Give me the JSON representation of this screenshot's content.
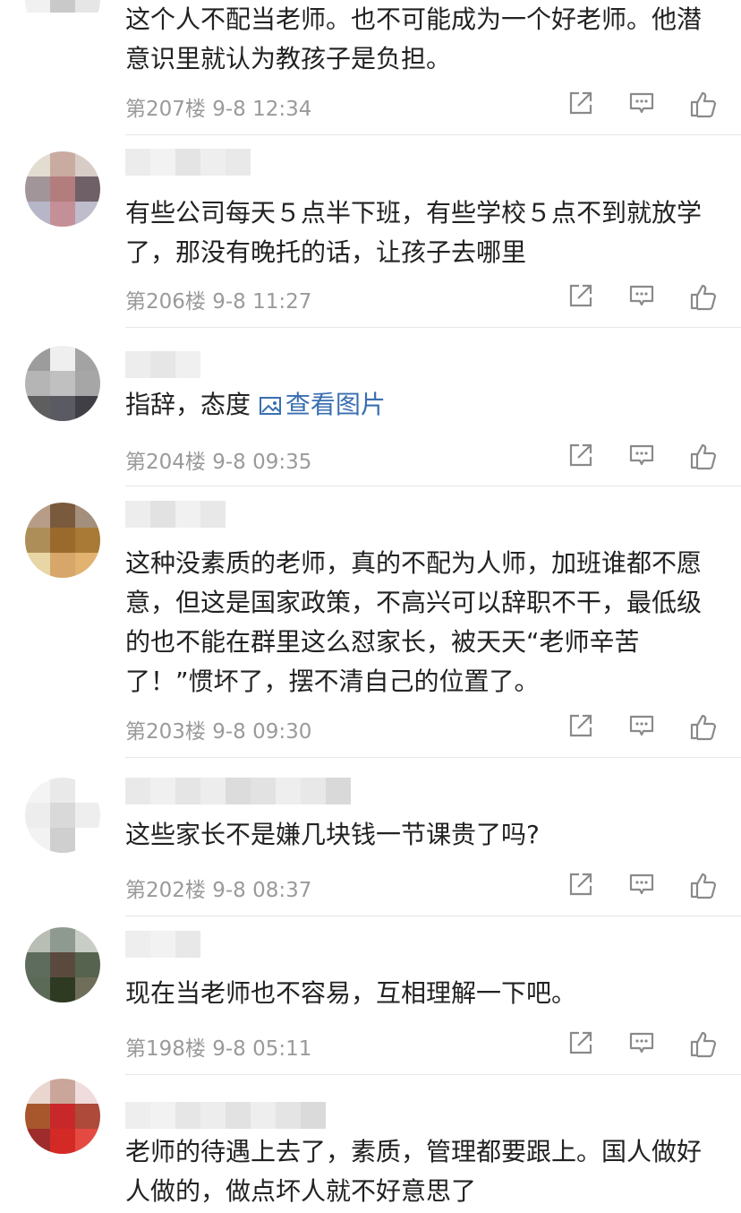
{
  "comments": [
    {
      "text": "这个人不配当老师。也不可能成为一个好老师。他潜意识里就认为教孩子是负担。",
      "floor": "第207楼",
      "time": "9-8 12:34",
      "avatar_colors": [
        "#8a98a8",
        "#d7c07a",
        "#7fb3c6",
        "#f1f1f1",
        "#c9c9c9",
        "#e6e6e6",
        "#ffffff",
        "#ffffff",
        "#ffffff"
      ]
    },
    {
      "text": "有些公司每天５点半下班，有些学校５点不到就放学了，那没有晚托的话，让孩子去哪里",
      "floor": "第206楼",
      "time": "9-8 11:27",
      "avatar_colors": [
        "#e3ddd1",
        "#c9aba1",
        "#d8ccc6",
        "#a29599",
        "#b47d7d",
        "#6f6068",
        "#b6b6c8",
        "#c58f98",
        "#bfbccb"
      ]
    },
    {
      "prefix": "指辞，态度",
      "link": "查看图片",
      "floor": "第204楼",
      "time": "9-8 09:35",
      "avatar_colors": [
        "#9c9c9c",
        "#efefef",
        "#a3a3a3",
        "#b5b5b5",
        "#c0c0c0",
        "#a6a6a6",
        "#5e5e5e",
        "#5a5a62",
        "#3f3f45"
      ]
    },
    {
      "text": "这种没素质的老师，真的不配为人师，加班谁都不愿意，但这是国家政策，不高兴可以辞职不干，最低级的也不能在群里这么怼家长，被天天“老师辛苦了！”惯坏了，摆不清自己的位置了。",
      "floor": "第203楼",
      "time": "9-8 09:30",
      "avatar_colors": [
        "#b79d87",
        "#7a5a3c",
        "#a48e7c",
        "#ae8e58",
        "#9a6a2c",
        "#a87a35",
        "#e8d6a6",
        "#d6a66a",
        "#e2b270"
      ]
    },
    {
      "text": "这些家长不是嫌几块钱一节课贵了吗?",
      "floor": "第202楼",
      "time": "9-8 08:37",
      "avatar_colors": [
        "#f4f4f4",
        "#e9e9e9",
        "#ffffff",
        "#ededed",
        "#d9d9d9",
        "#eeeeee",
        "#f2f2f2",
        "#cfcfcf",
        "#ffffff"
      ]
    },
    {
      "text": "现在当老师也不容易，互相理解一下吧。",
      "floor": "第198楼",
      "time": "9-8 05:11",
      "avatar_colors": [
        "#b9beb4",
        "#8e9a8f",
        "#c8cec6",
        "#5d6c5c",
        "#5a4a3e",
        "#56634f",
        "#5b6a57",
        "#2e3a22",
        "#6f6e5a"
      ]
    },
    {
      "text": "老师的待遇上去了，素质，管理都要跟上。国人做好人做的，做点坏人就不好意思了",
      "floor": "",
      "time": "",
      "avatar_colors": [
        "#e9d7cf",
        "#c9a59a",
        "#f0dcdc",
        "#a8572c",
        "#c8282a",
        "#ad4a3a",
        "#9e2c2c",
        "#d42a26",
        "#e44a42"
      ]
    }
  ],
  "icons": {
    "share": "share-icon",
    "reply": "comment-icon",
    "like": "thumbs-up-icon",
    "image": "image-icon"
  },
  "colors": {
    "text": "#222222",
    "meta": "#9a9a9a",
    "link": "#3a6fb0",
    "icon": "#8a8a8a",
    "divider": "#e6e6e6"
  }
}
